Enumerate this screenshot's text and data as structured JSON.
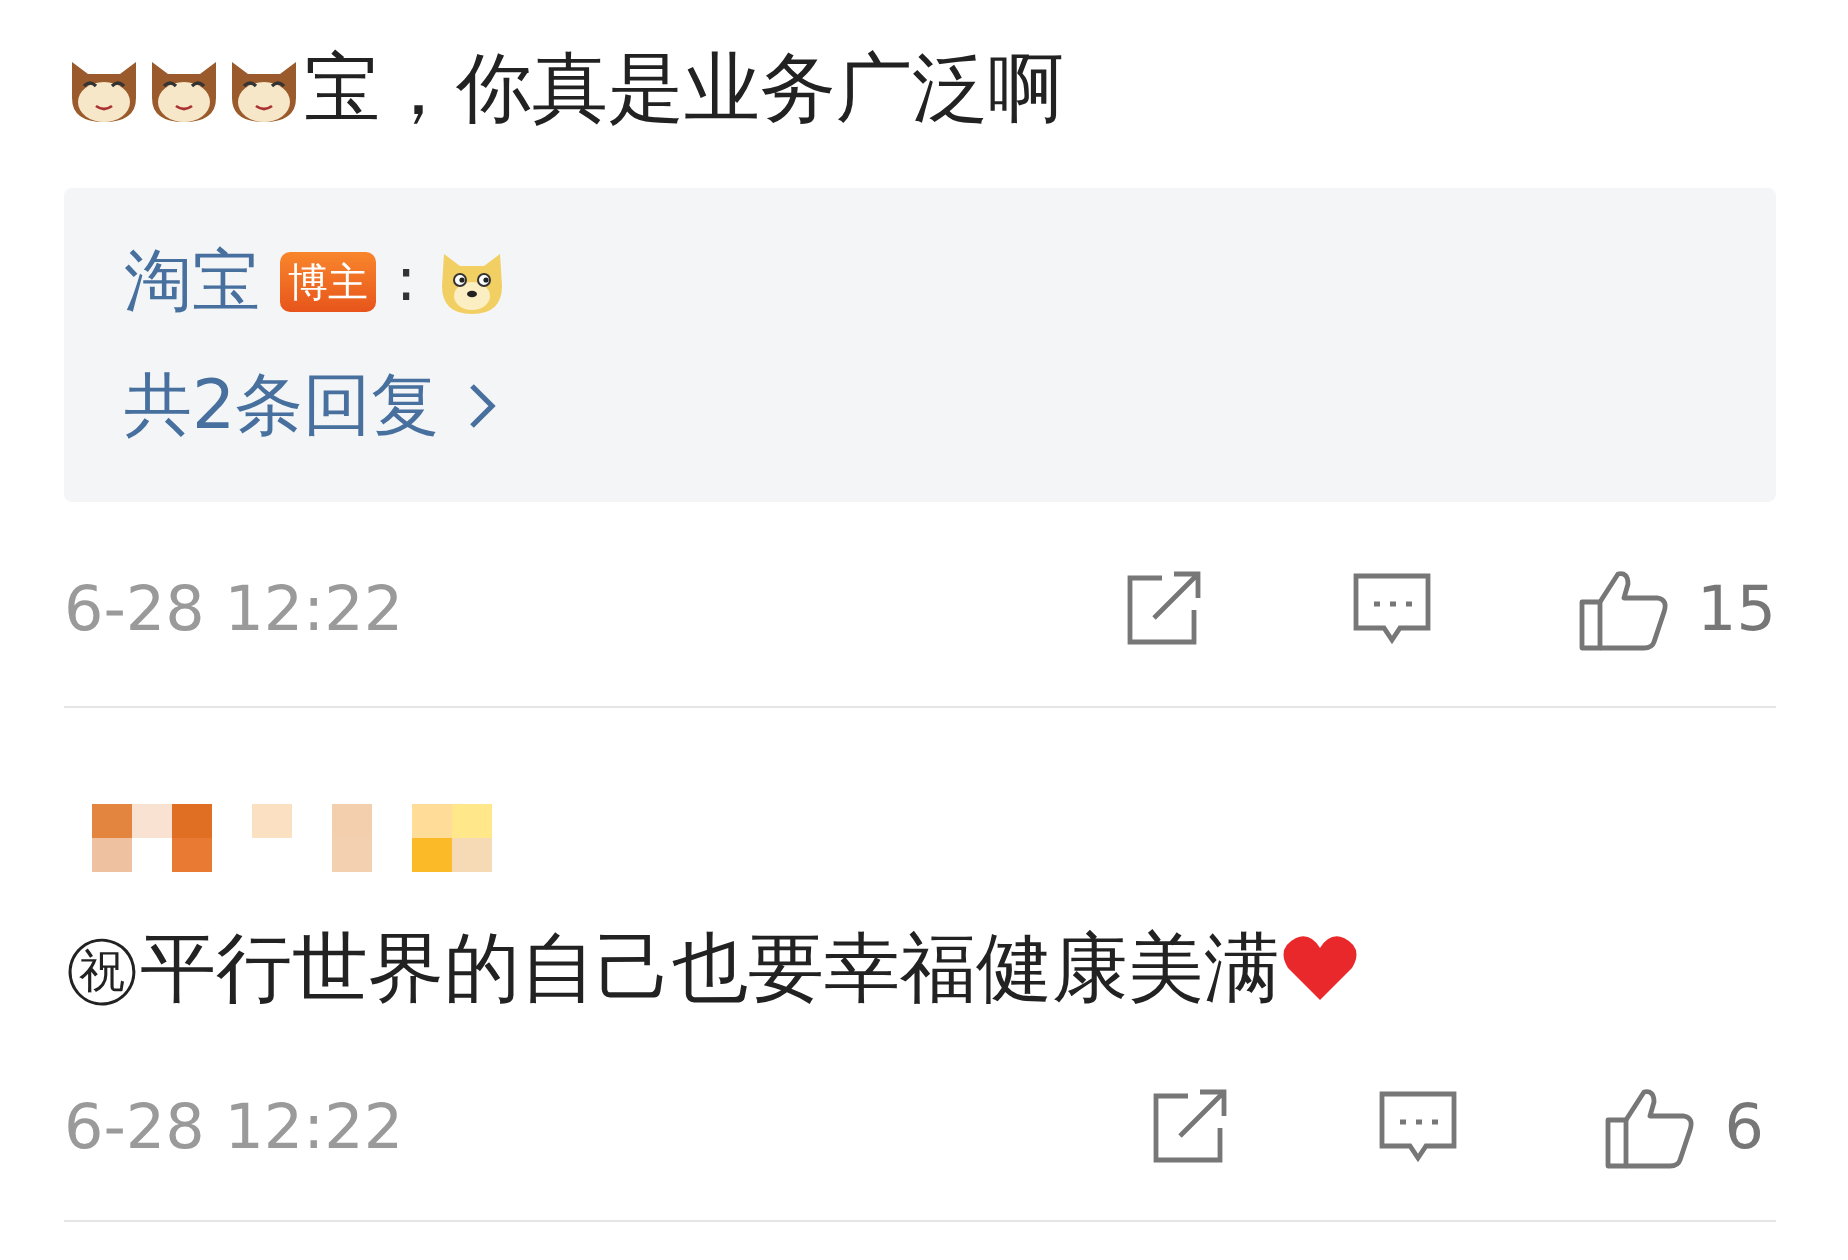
{
  "comments": [
    {
      "kind": "thread",
      "text": "宝，你真是业务广泛啊",
      "reply_box": {
        "author": "淘宝",
        "badge": "博主",
        "separator": ":",
        "more": "共2条回复"
      },
      "time": "6-28 12:22",
      "likes": "15"
    },
    {
      "kind": "named",
      "text": "㊗平行世界的自己也要幸福健康美满",
      "time": "6-28 12:22",
      "likes": "6"
    }
  ]
}
